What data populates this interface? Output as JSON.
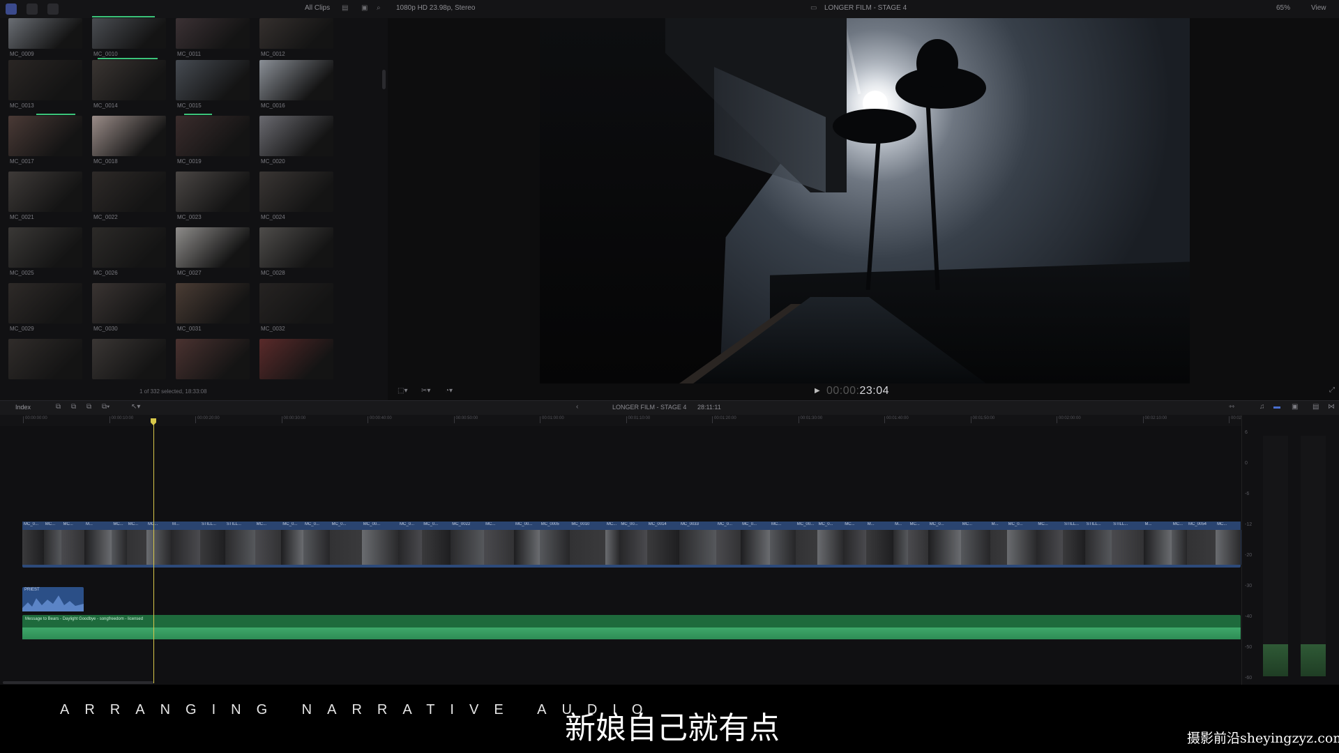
{
  "toolbar": {
    "clips_filter": "All Clips",
    "format_info": "1080p HD 23.98p, Stereo",
    "project_title": "LONGER FILM - STAGE 4",
    "zoom": "65%",
    "view_menu": "View"
  },
  "browser": {
    "clips": [
      {
        "name": "MC_0009",
        "tone": "#6a6e74"
      },
      {
        "name": "MC_0010",
        "tone": "#4a4d52"
      },
      {
        "name": "MC_0011",
        "tone": "#3b3134"
      },
      {
        "name": "MC_0012",
        "tone": "#35302e"
      },
      {
        "name": "MC_0013",
        "tone": "#2a2624"
      },
      {
        "name": "MC_0014",
        "tone": "#3a3532"
      },
      {
        "name": "MC_0015",
        "tone": "#464b52"
      },
      {
        "name": "MC_0016",
        "tone": "#8a8f96"
      },
      {
        "name": "MC_0017",
        "tone": "#4a3a36"
      },
      {
        "name": "MC_0018",
        "tone": "#9a8c88"
      },
      {
        "name": "MC_0019",
        "tone": "#3a2c2c"
      },
      {
        "name": "MC_0020",
        "tone": "#6a6a70"
      },
      {
        "name": "MC_0021",
        "tone": "#3e3a38"
      },
      {
        "name": "MC_0022",
        "tone": "#2e2a28"
      },
      {
        "name": "MC_0023",
        "tone": "#4a4644"
      },
      {
        "name": "MC_0024",
        "tone": "#3a3634"
      },
      {
        "name": "MC_0025",
        "tone": "#3a3836"
      },
      {
        "name": "MC_0026",
        "tone": "#2c2a28"
      },
      {
        "name": "MC_0027",
        "tone": "#8e8c8a"
      },
      {
        "name": "MC_0028",
        "tone": "#4e4c4a"
      },
      {
        "name": "MC_0029",
        "tone": "#2e2a28"
      },
      {
        "name": "MC_0030",
        "tone": "#3a3432"
      },
      {
        "name": "MC_0031",
        "tone": "#4a3c34"
      },
      {
        "name": "MC_0032",
        "tone": "#262322"
      },
      {
        "name": "",
        "tone": "#302c2a"
      },
      {
        "name": "",
        "tone": "#3a3634"
      },
      {
        "name": "",
        "tone": "#4a3230"
      },
      {
        "name": "",
        "tone": "#5a2a2a"
      }
    ],
    "status": "1 of 332 selected, 18:33:08"
  },
  "viewer": {
    "timecode_dim": "00:00:",
    "timecode": "23:04"
  },
  "timeline": {
    "index_label": "Index",
    "project_name": "LONGER FILM - STAGE 4",
    "duration": "28:11:11",
    "ruler": [
      "00:00:00:00",
      "00:00:10:00",
      "00:00:20:00",
      "00:00:30:00",
      "00:00:40:00",
      "00:00:50:00",
      "00:01:00:00",
      "00:01:10:00",
      "00:01:20:00",
      "00:01:30:00",
      "00:01:40:00",
      "00:01:50:00",
      "00:02:00:00",
      "00:02:10:00",
      "00:02:20:00"
    ],
    "music_clip_label": "PRIEST",
    "audio_label": "Message to Bears - Daylight Goodbye - songfreedom - licensed",
    "video_clips": [
      "MC_0...",
      "MC...",
      "MC...",
      "M...",
      "MC...",
      "MC...",
      "MC...",
      "M...",
      "STILL...",
      "STILL...",
      "MC...",
      "MC_0...",
      "MC_0...",
      "MC_0...",
      "MC_00...",
      "MC_0...",
      "MC_0...",
      "MC_0022",
      "MC...",
      "MC_00...",
      "MC_0005",
      "MC_0010",
      "MC...",
      "MC_00...",
      "MC_0014",
      "MC_0033",
      "MC_0...",
      "MC_0...",
      "MC...",
      "MC_00...",
      "MC_0...",
      "MC...",
      "M...",
      "M...",
      "MC...",
      "MC_0...",
      "MC...",
      "M...",
      "MC_0...",
      "MC...",
      "STILL...",
      "STILL...",
      "STILL...",
      "M...",
      "MC...",
      "MC_0054",
      "MC..."
    ]
  },
  "meters": {
    "scale": [
      "6",
      "0",
      "-6",
      "-12",
      "-20",
      "-30",
      "-40",
      "-50",
      "-60"
    ]
  },
  "captions": {
    "english": "ARRANGING NARRATIVE AUDIO",
    "chinese": "新娘自己就有点"
  },
  "watermark": "摄影前沿sheyingzyz.com",
  "colors": {
    "video_track": "#2d4a7a",
    "audio_track": "#1e6a3c",
    "playhead": "#d8c84a",
    "keyword_green": "#3cc47a"
  }
}
